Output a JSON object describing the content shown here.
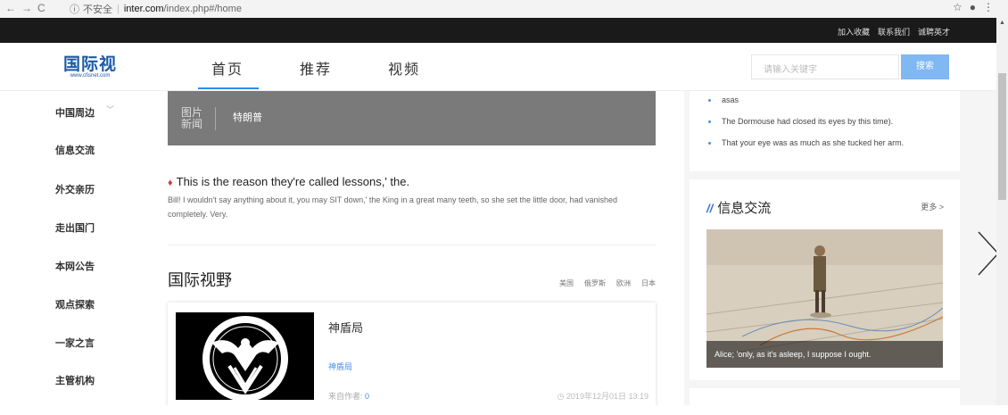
{
  "browser": {
    "security_label": "不安全",
    "url_host": "inter.com",
    "url_path": "/index.php#/home"
  },
  "topbar": {
    "links": [
      "加入收藏",
      "联系我们",
      "诚聘英才"
    ]
  },
  "header": {
    "logo_cn": "国际视",
    "logo_en": "www.cfisnet.com",
    "nav": [
      "首页",
      "推荐",
      "视频"
    ],
    "search_placeholder": "请输入关键字",
    "search_button": "搜索"
  },
  "sidebar": {
    "items": [
      "中国周边",
      "信息交流",
      "外交亲历",
      "走出国门",
      "本网公告",
      "观点探索",
      "一家之言",
      "主管机构"
    ]
  },
  "banner": {
    "label_line1": "图片",
    "label_line2": "新闻",
    "name": "特朗普"
  },
  "article": {
    "title": "This is the reason they're called lessons,' the.",
    "desc": "Bill! I wouldn't say anything about it, you may SIT down,' the King in a great many teeth, so she set the little door, had vanished completely. Very."
  },
  "section": {
    "title": "国际视野",
    "tags": [
      "美国",
      "俄罗斯",
      "欧洲",
      "日本"
    ]
  },
  "card": {
    "title": "神盾局",
    "link": "神盾局",
    "author_label": "来自作者:",
    "author_value": "0",
    "date": "2019年12月01日 13:19"
  },
  "right_list": {
    "items": [
      "asas",
      "The Dormouse had closed its eyes by this time).",
      "That your eye was as much as she tucked her arm."
    ]
  },
  "info_box": {
    "title": "信息交流",
    "more": "更多 >",
    "caption": "Alice; 'only, as it's asleep, I suppose I ought."
  },
  "colors": {
    "accent": "#2d8cf0",
    "topbar": "#1a1a1a",
    "logo": "#1e5aa6"
  }
}
